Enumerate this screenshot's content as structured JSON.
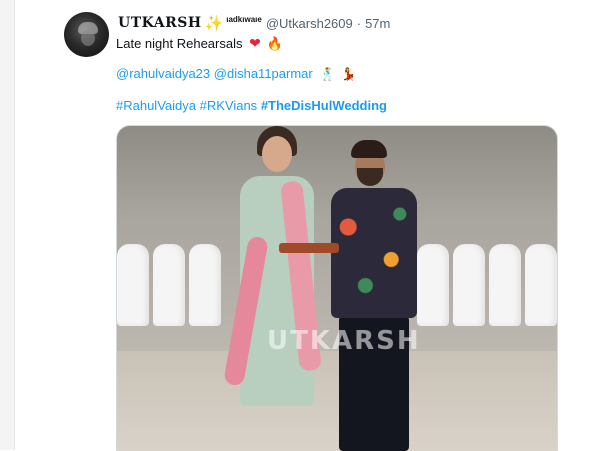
{
  "tweet": {
    "author_name": "UTKARSH",
    "name_emoji": "✨",
    "name_suffix": "ıadkıwaıe",
    "handle": "@Utkarsh2609",
    "separator": "·",
    "time": "57m",
    "text": "Late night Rehearsals",
    "text_emojis": [
      "❤",
      "🔥"
    ],
    "mentions": [
      "@rahulvaidya23",
      "@disha11parmar"
    ],
    "mention_emojis": [
      "🕺",
      "💃"
    ],
    "hashtags": [
      "#RahulVaidya",
      "#RKVians",
      "#TheDisHulWedding"
    ],
    "media": {
      "watermark": "UTKARSH"
    }
  },
  "colors": {
    "link": "#1d9bf0",
    "text": "#0f1419",
    "secondary": "#536471"
  }
}
